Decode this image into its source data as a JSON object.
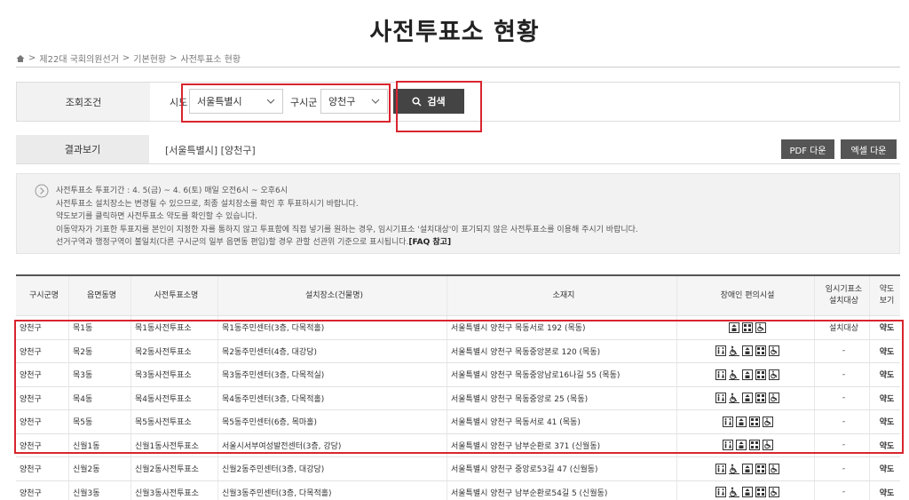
{
  "page": {
    "title": "사전투표소 현황"
  },
  "breadcrumb": [
    "제22대 국회의원선거",
    "기본현황",
    "사전투표소 현황"
  ],
  "filter": {
    "label": "조회조건",
    "sido_label": "시도",
    "sido_value": "서울특별시",
    "gu_label": "구시군",
    "gu_value": "양천구",
    "search_label": "검색"
  },
  "result": {
    "label": "결과보기",
    "text": "[서울특별시] [양천구]",
    "pdf_label": "PDF 다운",
    "excel_label": "엑셀 다운"
  },
  "notice": {
    "lines": [
      "사전투표소 투표기간 : 4. 5(금) ~ 4. 6(토) 매일 오전6시 ~ 오후6시",
      "사전투표소 설치장소는 변경될 수 있으므로, 최종 설치장소를 확인 후 투표하시기 바랍니다.",
      "약도보기를 클릭하면 사전투표소 약도를 확인할 수 있습니다.",
      "이동약자가 기표한 투표지를 본인이 지정한 자를 통하지 않고 투표함에 직접 넣기를 원하는 경우, 임시기표소 '설치대상'이 표기되지 않은 사전투표소를 이용해 주시기 바랍니다.",
      "선거구역과 행정구역이 불일치(다른 구시군의 일부 읍면동 편입)할 경우 관할 선관위 기준으로 표시됩니다."
    ],
    "faq": "[FAQ 참고]"
  },
  "table": {
    "headers": [
      "구시군명",
      "읍면동명",
      "사전투표소명",
      "설치장소(건물명)",
      "소재지",
      "장애인 편의시설",
      "임시기표소\n설치대상",
      "약도\n보기"
    ],
    "rows": [
      {
        "gu": "양천구",
        "dong": "목1동",
        "name": "목1동사전투표소",
        "place": "목1동주민센터(3층, 다목적홀)",
        "addr": "서울특별시 양천구 목동서로 192 (목동)",
        "temp": "설치대상",
        "map": "약도"
      },
      {
        "gu": "양천구",
        "dong": "목2동",
        "name": "목2동사전투표소",
        "place": "목2동주민센터(4층, 대강당)",
        "addr": "서울특별시 양천구 목동중앙본로 120 (목동)",
        "temp": "-",
        "map": "약도"
      },
      {
        "gu": "양천구",
        "dong": "목3동",
        "name": "목3동사전투표소",
        "place": "목3동주민센터(3층, 다목적실)",
        "addr": "서울특별시 양천구 목동중앙남로16나길 55 (목동)",
        "temp": "-",
        "map": "약도"
      },
      {
        "gu": "양천구",
        "dong": "목4동",
        "name": "목4동사전투표소",
        "place": "목4동주민센터(3층, 다목적홀)",
        "addr": "서울특별시 양천구 목동중앙로 25 (목동)",
        "temp": "-",
        "map": "약도"
      },
      {
        "gu": "양천구",
        "dong": "목5동",
        "name": "목5동사전투표소",
        "place": "목5동주민센터(6층, 목마홀)",
        "addr": "서울특별시 양천구 목동서로 41 (목동)",
        "temp": "-",
        "map": "약도"
      },
      {
        "gu": "양천구",
        "dong": "신월1동",
        "name": "신월1동사전투표소",
        "place": "서울시서부여성발전센터(3층, 강당)",
        "addr": "서울특별시 양천구 남부순환로 371 (신월동)",
        "temp": "-",
        "map": "약도"
      },
      {
        "gu": "양천구",
        "dong": "신월2동",
        "name": "신월2동사전투표소",
        "place": "신월2동주민센터(3층, 대강당)",
        "addr": "서울특별시 양천구 중앙로53길 47 (신월동)",
        "temp": "-",
        "map": "약도"
      },
      {
        "gu": "양천구",
        "dong": "신월3동",
        "name": "신월3동사전투표소",
        "place": "신월3동주민센터(3층, 다목적홀)",
        "addr": "서울특별시 양천구 남부순환로54길 5 (신월동)",
        "temp": "-",
        "map": "약도"
      }
    ],
    "facility_icons": [
      [
        "elevator-icon",
        "braille-icon",
        "wheelchair-icon"
      ],
      [
        "restroom-icon",
        "wheelchair-ramp-icon",
        "elevator-icon",
        "braille-icon",
        "wheelchair-icon"
      ],
      [
        "restroom-icon",
        "wheelchair-ramp-icon",
        "elevator-icon",
        "braille-icon",
        "wheelchair-icon"
      ],
      [
        "restroom-icon",
        "wheelchair-ramp-icon",
        "elevator-icon",
        "braille-icon",
        "wheelchair-icon"
      ],
      [
        "restroom-icon",
        "elevator-icon",
        "braille-icon",
        "wheelchair-icon"
      ],
      [
        "restroom-icon",
        "elevator-icon",
        "braille-icon",
        "wheelchair-icon"
      ],
      [
        "restroom-icon",
        "wheelchair-ramp-icon",
        "elevator-icon",
        "braille-icon",
        "wheelchair-icon"
      ],
      [
        "restroom-icon",
        "wheelchair-ramp-icon",
        "elevator-icon",
        "braille-icon",
        "wheelchair-icon"
      ]
    ]
  },
  "colors": {
    "highlight": "#d9252e",
    "button": "#444444"
  }
}
